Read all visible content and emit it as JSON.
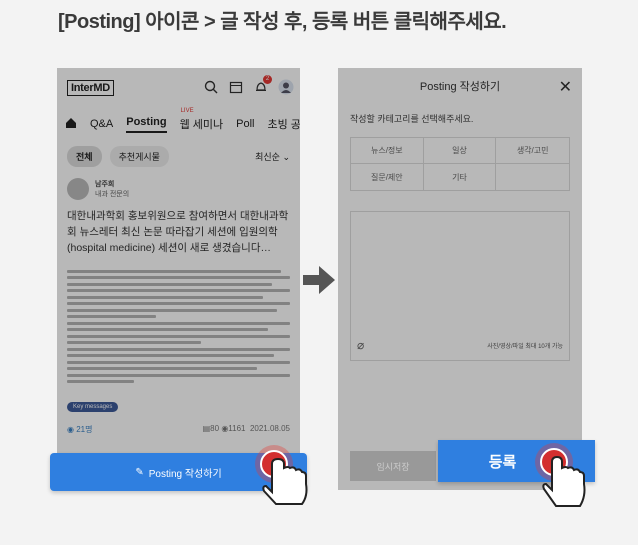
{
  "headline": "[Posting] 아이콘 > 글 작성 후, 등록 버튼 클릭해주세요.",
  "left": {
    "logo": "InterMD",
    "nav": [
      "Q&A",
      "Posting",
      "웹 세미나",
      "Poll",
      "초빙 공고"
    ],
    "live": "LIVE",
    "badge": "2",
    "filters": [
      "전체",
      "추천게시물"
    ],
    "sort": "최신순",
    "author_name": "남주희",
    "author_sub": "내과 전문의",
    "post_title": "대한내과학회 홍보위원으로 참여하면서 대한내과학회 뉴스레터 최신 논문 따라잡기 세션에 입원의학(hospital medicine) 세션이 새로 생겼습니다…",
    "keyword": "Key messages",
    "likes": "21명",
    "comments": "80",
    "views": "1161",
    "date": "2021.08.05",
    "posting_button": "Posting 작성하기"
  },
  "right": {
    "title": "Posting 작성하기",
    "category_hint": "작성할 카테고리를 선택해주세요.",
    "categories": [
      "뉴스/정보",
      "일상",
      "생각/고민",
      "질문/제안",
      "기타",
      ""
    ],
    "attach_hint": "사진/영상/파일 최대 10개 가능",
    "temp_save": "임시저장",
    "register": "등록"
  },
  "colors": {
    "accent": "#2f7fe0",
    "live": "#e53935"
  }
}
